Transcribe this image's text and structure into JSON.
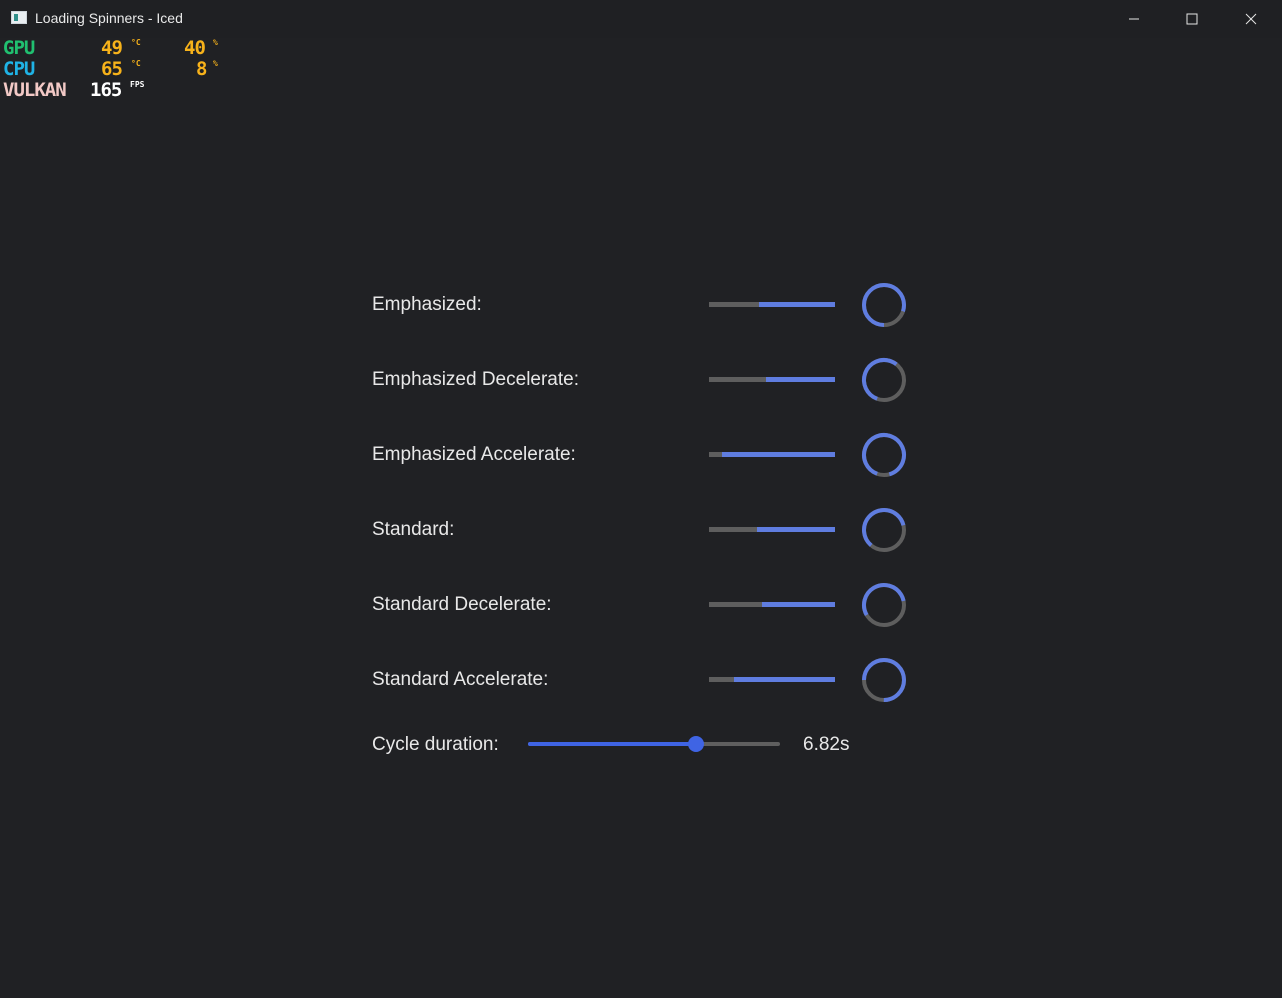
{
  "window": {
    "title": "Loading Spinners - Iced",
    "controls": [
      "minimize-icon",
      "maximize-icon",
      "close-icon"
    ]
  },
  "overlay": {
    "gpu": {
      "label": "GPU",
      "temp": "49",
      "temp_unit": "°C",
      "load": "40",
      "load_unit": "%"
    },
    "cpu": {
      "label": "CPU",
      "temp": "65",
      "temp_unit": "°C",
      "load": "8",
      "load_unit": "%"
    },
    "api": {
      "label": "VULKAN",
      "fps": "165",
      "fps_unit": "FPS"
    },
    "colors": {
      "gpu": "#20c070",
      "cpu": "#1fb3e6",
      "value": "#f7b21a",
      "api": "#f2c9c6",
      "fps": "#ffffff"
    }
  },
  "easings": [
    {
      "label": "Emphasized:",
      "bar_fill": 0.6,
      "arc_fraction": 0.8,
      "arc_start_deg": 0
    },
    {
      "label": "Emphasized Decelerate:",
      "bar_fill": 0.55,
      "arc_fraction": 0.55,
      "arc_start_deg": 20
    },
    {
      "label": "Emphasized Accelerate:",
      "bar_fill": 0.9,
      "arc_fraction": 0.9,
      "arc_start_deg": 20
    },
    {
      "label": "Standard:",
      "bar_fill": 0.62,
      "arc_fraction": 0.6,
      "arc_start_deg": 40
    },
    {
      "label": "Standard Decelerate:",
      "bar_fill": 0.58,
      "arc_fraction": 0.55,
      "arc_start_deg": 60
    },
    {
      "label": "Standard Accelerate:",
      "bar_fill": 0.8,
      "arc_fraction": 0.75,
      "arc_start_deg": 90
    }
  ],
  "cycle": {
    "label": "Cycle duration:",
    "value_label": "6.82s",
    "slider_fraction": 0.665
  },
  "colors": {
    "background": "#202124",
    "accent": "#5f7de0",
    "slider_accent": "#3f64e4",
    "track": "#5e5e5e"
  }
}
